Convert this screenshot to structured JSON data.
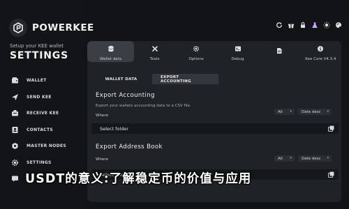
{
  "brand": {
    "name": "POWERKEE"
  },
  "sidebar": {
    "setup_text": "Setup your KEE wallet",
    "title": "SETTINGS",
    "items": [
      {
        "label": "WALLET",
        "icon": "wallet-icon"
      },
      {
        "label": "SEND KEE",
        "icon": "send-icon"
      },
      {
        "label": "RECEIVE KEE",
        "icon": "receive-icon"
      },
      {
        "label": "CONTACTS",
        "icon": "contacts-icon"
      },
      {
        "label": "MASTER NODES",
        "icon": "masternodes-icon"
      },
      {
        "label": "SETTINGS",
        "icon": "gear-icon"
      },
      {
        "label": "",
        "icon": "chat-icon"
      }
    ]
  },
  "toolbar": {
    "icons": [
      "refresh-icon",
      "gift-icon",
      "lock-icon",
      "flask-icon",
      "sun-icon",
      "palette-icon"
    ]
  },
  "top_tabs": [
    {
      "label": "Wallet data",
      "icon": "database-icon"
    },
    {
      "label": "Tools",
      "icon": "tools-icon"
    },
    {
      "label": "Options",
      "icon": "options-icon"
    },
    {
      "label": "Debug",
      "icon": "debug-icon"
    },
    {
      "label": "",
      "icon": "document-icon"
    },
    {
      "label": "Kee Core V4.3.4",
      "icon": "info-icon"
    }
  ],
  "sub_tabs": [
    {
      "label": "WALLET DATA",
      "active": true
    },
    {
      "label": "EXPORT ACCOUNTING",
      "active": false
    }
  ],
  "export_accounting": {
    "title": "Export Accounting",
    "subtitle": "Export your wallets accounting data to a CSV file.",
    "where_label": "Where",
    "filter_value": "All",
    "sort_value": "Date desc",
    "folder_placeholder": "Select folder"
  },
  "export_address_book": {
    "title": "Export Address Book",
    "where_label": "Where",
    "filter_value": "All",
    "sort_value": "Date desc",
    "folder_placeholder": "Select folder"
  },
  "caption": "USDT的意义:了解稳定币的价值与应用",
  "colors": {
    "background": "#111317",
    "panel": "#1f2227",
    "accent": "#3a3e45"
  }
}
